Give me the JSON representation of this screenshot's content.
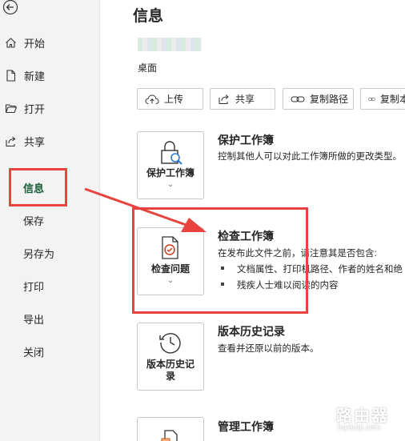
{
  "sidebar": {
    "items": [
      {
        "label": "开始",
        "icon": "home-icon"
      },
      {
        "label": "新建",
        "icon": "new-document-icon"
      },
      {
        "label": "打开",
        "icon": "folder-open-icon"
      },
      {
        "label": "共享",
        "icon": "share-icon"
      },
      {
        "label": "信息",
        "active": true
      },
      {
        "label": "保存"
      },
      {
        "label": "另存为"
      },
      {
        "label": "打印"
      },
      {
        "label": "导出"
      },
      {
        "label": "关闭"
      }
    ]
  },
  "main": {
    "title": "信息",
    "folder": "桌面",
    "buttons": [
      {
        "label": "上传",
        "icon": "upload-icon"
      },
      {
        "label": "共享",
        "icon": "share-icon"
      },
      {
        "label": "复制路径",
        "icon": "link-icon"
      },
      {
        "label": "复制本",
        "icon": "link-icon"
      }
    ],
    "sections": [
      {
        "card_label": "保护工作簿",
        "title": "保护工作簿",
        "desc": "控制其他人可以对此工作簿所做的更改类型。"
      },
      {
        "card_label": "检查问题",
        "title": "检查工作簿",
        "desc": "在发布此文件之前，请注意其是否包含:",
        "bullets": [
          "文档属性、打印机路径、作者的姓名和绝",
          "残疾人士难以阅读的内容"
        ]
      },
      {
        "card_label_line1": "版本历史记",
        "card_label_line2": "录",
        "title": "版本历史记录",
        "desc": "查看并还原以前的版本。"
      },
      {
        "title": "管理工作簿"
      }
    ]
  },
  "watermark": {
    "text": "路由器",
    "url": "luyouqi.com"
  },
  "colors": {
    "accent": "#185c37",
    "highlight": "#e8433e"
  }
}
